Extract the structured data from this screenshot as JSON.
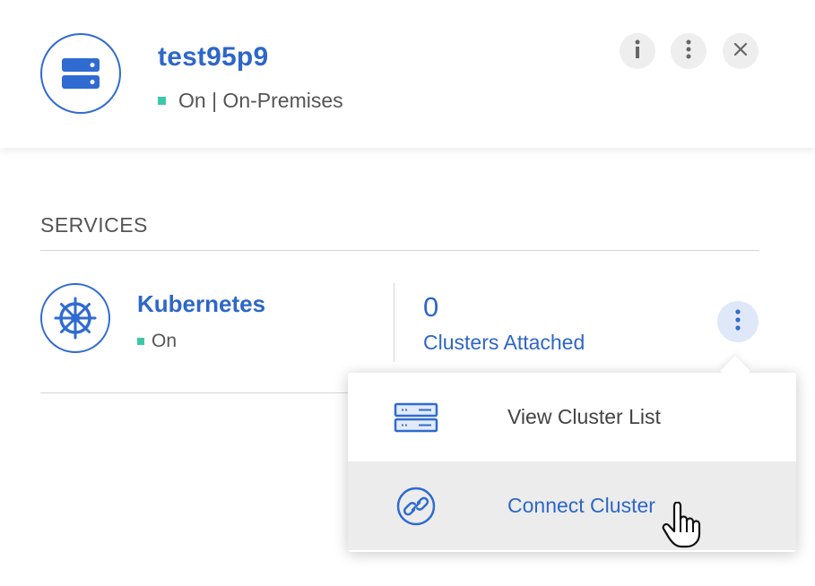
{
  "environment": {
    "name": "test95p9",
    "status": "On | On-Premises",
    "status_color": "#3cc9a9",
    "icon": "server-icon",
    "actions": [
      {
        "name": "info-icon"
      },
      {
        "name": "more-vertical-icon"
      },
      {
        "name": "close-icon"
      }
    ]
  },
  "services": {
    "heading": "SERVICES",
    "kubernetes": {
      "name": "Kubernetes",
      "status": "On",
      "icon": "kubernetes-helm-icon",
      "clusters_count": "0",
      "clusters_label": "Clusters Attached"
    }
  },
  "menu": {
    "items": [
      {
        "label": "View Cluster List",
        "icon": "cluster-list-icon"
      },
      {
        "label": "Connect Cluster",
        "icon": "link-icon",
        "hovered": true
      }
    ]
  },
  "colors": {
    "accent": "#2d67c8",
    "status_on": "#3cc9a9",
    "hover_bg": "#ececec"
  }
}
